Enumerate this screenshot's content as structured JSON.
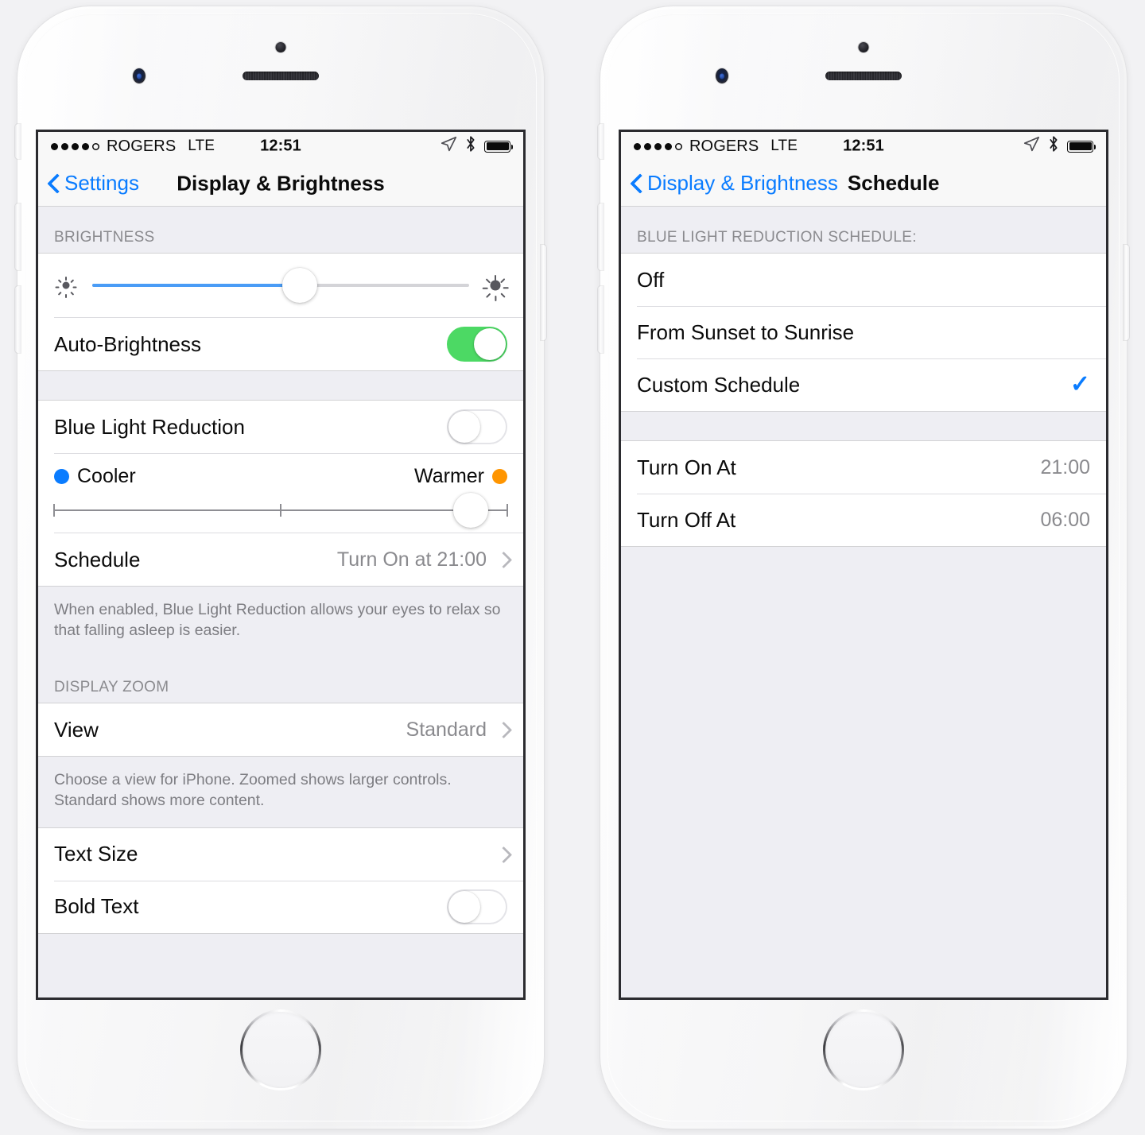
{
  "status_bar": {
    "signal_dots_filled": 4,
    "signal_dots_total": 5,
    "carrier": "ROGERS",
    "network": "LTE",
    "time": "12:51",
    "icons": [
      "location-arrow-icon",
      "bluetooth-icon",
      "battery-icon"
    ]
  },
  "left_phone": {
    "nav": {
      "back_label": "Settings",
      "title": "Display & Brightness"
    },
    "brightness_section": {
      "header": "BRIGHTNESS",
      "slider": {
        "value_percent": 55,
        "min_icon": "sun-small-icon",
        "max_icon": "sun-large-icon"
      },
      "auto_brightness": {
        "label": "Auto-Brightness",
        "state": "on"
      }
    },
    "blue_light_section": {
      "blue_light_reduction": {
        "label": "Blue Light Reduction",
        "state": "off"
      },
      "temperature": {
        "cooler_label": "Cooler",
        "warmer_label": "Warmer",
        "cooler_color": "#0a7cff",
        "warmer_color": "#ff9500",
        "value_percent": 92
      },
      "schedule": {
        "label": "Schedule",
        "value": "Turn On at 21:00",
        "accessory": "chevron-right-icon"
      },
      "footer": "When enabled, Blue Light Reduction allows your eyes to relax so that falling asleep is easier."
    },
    "display_zoom_section": {
      "header": "DISPLAY ZOOM",
      "view": {
        "label": "View",
        "value": "Standard",
        "accessory": "chevron-right-icon"
      },
      "footer": "Choose a view for iPhone. Zoomed shows larger controls. Standard shows more content."
    },
    "text_section": {
      "text_size": {
        "label": "Text Size",
        "accessory": "chevron-right-icon"
      },
      "bold_text": {
        "label": "Bold Text",
        "state": "off"
      }
    }
  },
  "right_phone": {
    "nav": {
      "back_label": "Display & Brightness",
      "title": "Schedule"
    },
    "schedule_section": {
      "header": "BLUE LIGHT REDUCTION SCHEDULE:",
      "options": [
        {
          "label": "Off",
          "selected": false
        },
        {
          "label": "From Sunset to Sunrise",
          "selected": false
        },
        {
          "label": "Custom Schedule",
          "selected": true
        }
      ],
      "checkmark_glyph": "✓"
    },
    "times_section": {
      "rows": [
        {
          "label": "Turn On At",
          "value": "21:00"
        },
        {
          "label": "Turn Off At",
          "value": "06:00"
        }
      ]
    }
  },
  "colors": {
    "accent_blue": "#0a7cff",
    "toggle_green": "#4cd964",
    "slider_blue": "#4a9cf6",
    "group_bg": "#eeeef3",
    "secondary_text": "#8a8a8e"
  }
}
